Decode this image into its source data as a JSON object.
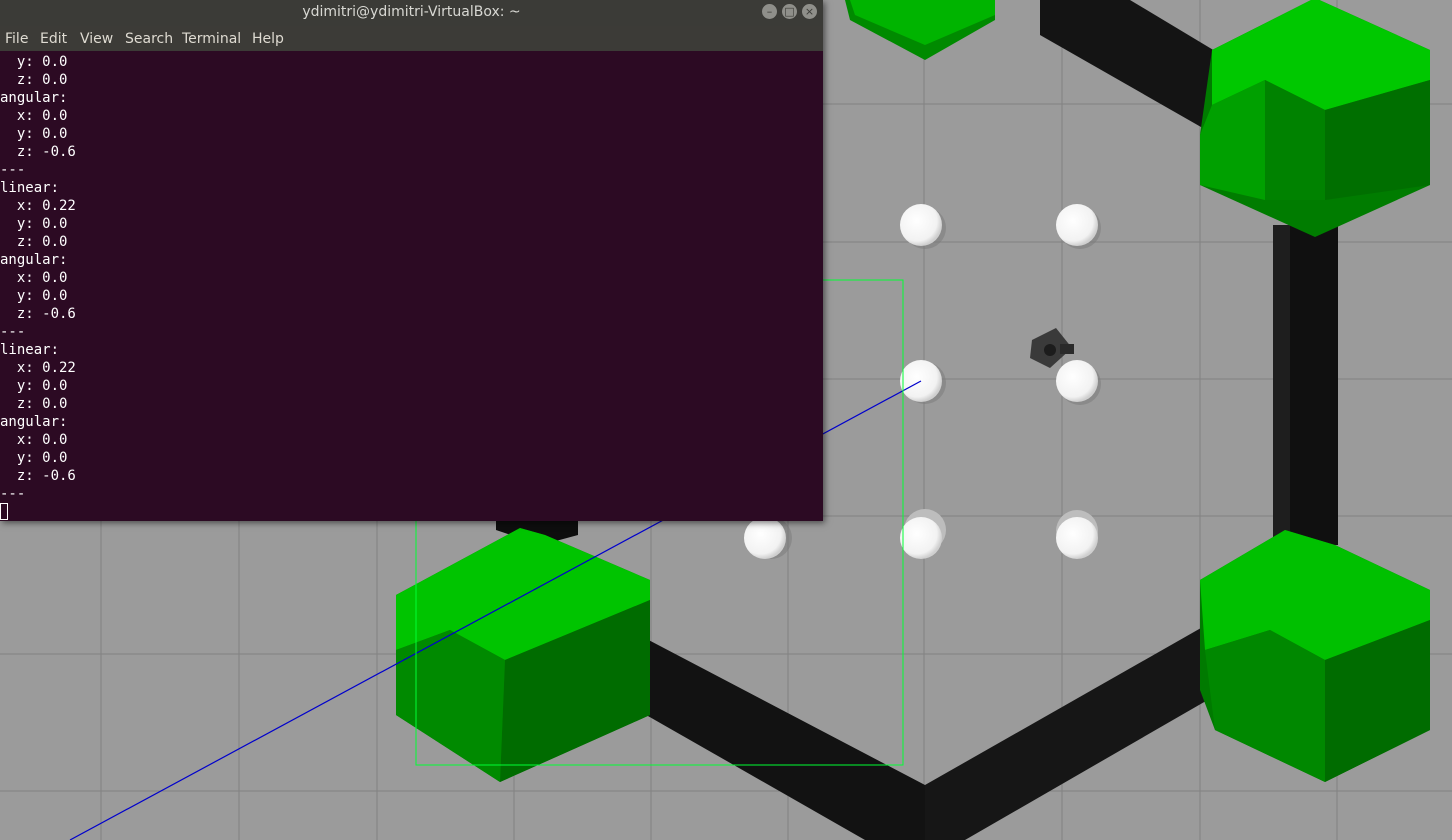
{
  "window": {
    "title": "ydimitri@ydimitri-VirtualBox: ~",
    "buttons": {
      "minimize": "–",
      "maximize": "□",
      "close": "×"
    }
  },
  "menu": [
    "File",
    "Edit",
    "View",
    "Search",
    "Terminal",
    "Help"
  ],
  "terminal_lines": [
    "  y: 0.0",
    "  z: 0.0",
    "angular:",
    "  x: 0.0",
    "  y: 0.0",
    "  z: -0.6",
    "---",
    "linear:",
    "  x: 0.22",
    "  y: 0.0",
    "  z: 0.0",
    "angular:",
    "  x: 0.0",
    "  y: 0.0",
    "  z: -0.6",
    "---",
    "linear:",
    "  x: 0.22",
    "  y: 0.0",
    "  z: 0.0",
    "angular:",
    "  x: 0.0",
    "  y: 0.0",
    "  z: -0.6",
    "---"
  ],
  "colors": {
    "terminal_bg": "#2c0a23",
    "ground": "#9b9b9b",
    "hex_green": "#009a00",
    "wall": "#111111",
    "pillar": "#ffffff"
  }
}
